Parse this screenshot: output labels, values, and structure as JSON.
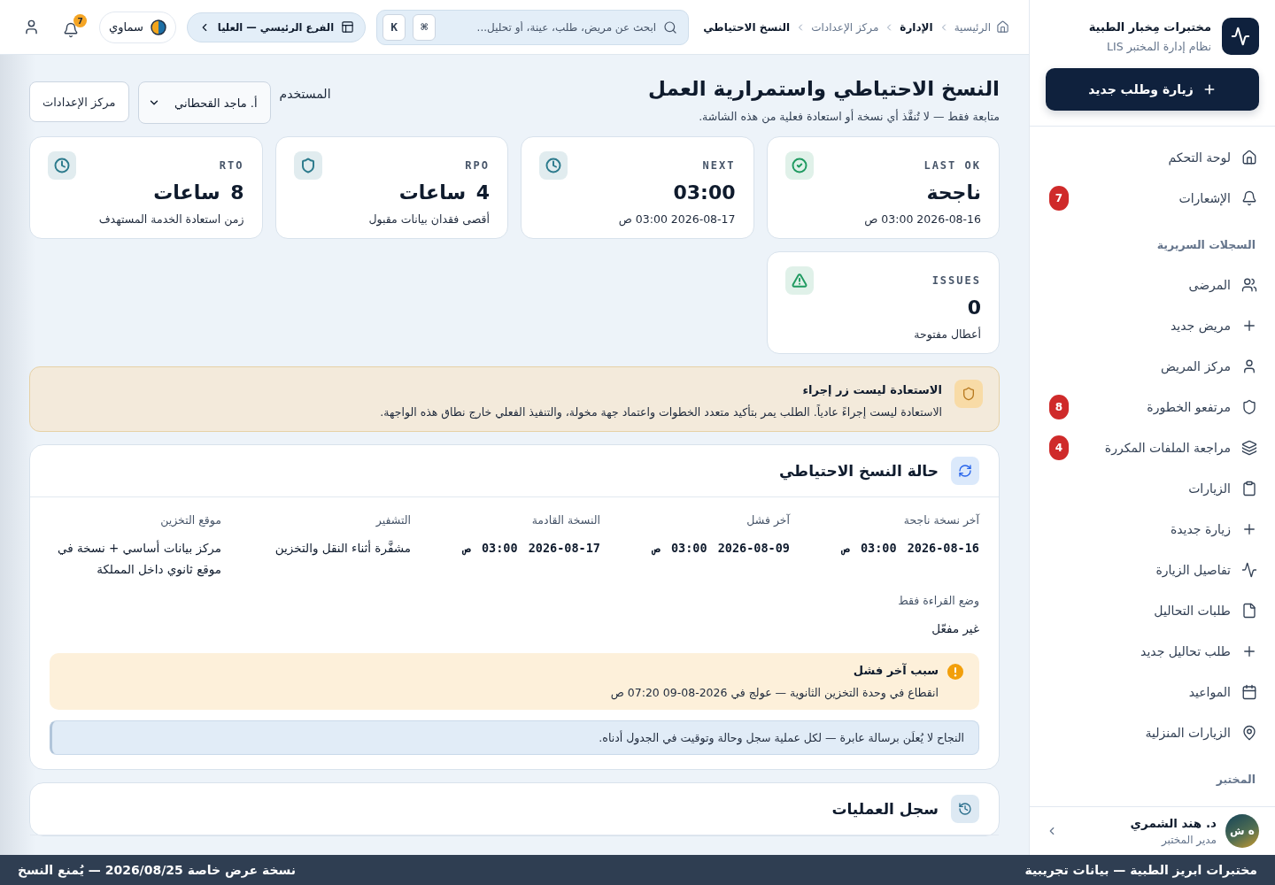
{
  "sidebar": {
    "brand": {
      "title": "مختبرات مِخبار الطبية",
      "subtitle": "نظام إدارة المختبر LIS"
    },
    "primary_action": "زيارة وطلب جديد",
    "nav": [
      {
        "kind": "link",
        "label": "لوحة التحكم",
        "selected": false
      },
      {
        "kind": "link",
        "label": "الإشعارات",
        "selected": false,
        "badge": "7"
      },
      {
        "kind": "section",
        "label": "السجلات السريرية"
      },
      {
        "kind": "link",
        "label": "المرضى",
        "selected": false
      },
      {
        "kind": "link",
        "label": "مريض جديد",
        "selected": false
      },
      {
        "kind": "link",
        "label": "مركز المريض",
        "selected": false
      },
      {
        "kind": "link",
        "label": "مرتفعو الخطورة",
        "selected": false,
        "badge": "8"
      },
      {
        "kind": "link",
        "label": "مراجعة الملفات المكررة",
        "selected": false,
        "badge": "4"
      },
      {
        "kind": "link",
        "label": "الزيارات",
        "selected": false
      },
      {
        "kind": "link",
        "label": "زيارة جديدة",
        "selected": false
      },
      {
        "kind": "link",
        "label": "تفاصيل الزيارة",
        "selected": false
      },
      {
        "kind": "link",
        "label": "طلبات التحاليل",
        "selected": false
      },
      {
        "kind": "link",
        "label": "طلب تحاليل جديد",
        "selected": false
      },
      {
        "kind": "link",
        "label": "المواعيد",
        "selected": false
      },
      {
        "kind": "link",
        "label": "الزيارات المنزلية",
        "selected": false
      },
      {
        "kind": "section",
        "label": "المختبر"
      }
    ],
    "user": {
      "initials": "ه ش",
      "name": "د. هند الشمري",
      "role": "مدير المختبر"
    }
  },
  "topbar": {
    "breadcrumb": [
      {
        "kind": "home",
        "label": "الرئيسية"
      },
      {
        "kind": "section",
        "label": "الإدارة"
      },
      {
        "kind": "link",
        "label": "مركز الإعدادات"
      },
      {
        "kind": "current",
        "label": "النسخ الاحتياطي"
      }
    ],
    "search": {
      "placeholder": "ابحث عن مريض، طلب، عينة، أو تحليل...",
      "shortcut": [
        "⌘",
        "K"
      ]
    },
    "branch": "الفرع الرئيسي — العليا",
    "theme": "سماوي",
    "notifications": "7"
  },
  "page": {
    "title": "النسخ الاحتياطي واستمرارية العمل",
    "subtitle": "متابعة فقط — لا تُنفَّذ أي نسخة أو استعادة فعلية من هذه الشاشة.",
    "user_filter": {
      "label": "المستخدم",
      "value": "أ. ماجد القحطاني"
    },
    "settings_button": "مركز الإعدادات"
  },
  "kpis": [
    {
      "label": "LAST OK",
      "value": "ناجحة",
      "note": "2026-08-16 03:00 ص",
      "color": "#1f9a60"
    },
    {
      "label": "NEXT",
      "value": "03:00",
      "note": "2026-08-17 03:00 ص",
      "color": "#2b7a8c"
    },
    {
      "label": "RPO",
      "value": "4 ساعات",
      "note": "أقصى فقدان بيانات مقبول",
      "color": "#2b7a8c"
    },
    {
      "label": "RTO",
      "value": "8 ساعات",
      "note": "زمن استعادة الخدمة المستهدف",
      "color": "#2b7a8c"
    },
    {
      "label": "ISSUES",
      "value": "0",
      "note": "أعطال مفتوحة",
      "color": "#1f9a60"
    }
  ],
  "restore_notice": {
    "title": "الاستعادة ليست زر إجراء",
    "text": "الاستعادة ليست إجراءً عادياً. الطلب يمر بتأكيد متعدد الخطوات واعتماد جهة مخولة، والتنفيذ الفعلي خارج نطاق هذه الواجهة."
  },
  "backup_status": {
    "title": "حالة النسخ الاحتياطي",
    "fields": [
      {
        "kind": "datetime",
        "label": "آخر نسخة ناجحة",
        "value": "2026-08-16 03:00 ص"
      },
      {
        "kind": "datetime",
        "label": "آخر فشل",
        "value": "2026-08-09 03:00 ص"
      },
      {
        "kind": "datetime",
        "label": "النسخة القادمة",
        "value": "2026-08-17 03:00 ص"
      },
      {
        "kind": "text",
        "label": "التشفير",
        "value": "مشفَّرة أثناء النقل والتخزين"
      },
      {
        "kind": "text",
        "label": "موقع التخزين",
        "value": "مركز بيانات أساسي + نسخة في موقع ثانوي داخل المملكة"
      },
      {
        "kind": "text",
        "label": "وضع القراءة فقط",
        "value": "غير مفعّل"
      }
    ],
    "failure": {
      "title": "سبب آخر فشل",
      "text": "انقطاع في وحدة التخزين الثانوية — عولج في 2026-08-09 07:20 ص"
    },
    "note": "النجاح لا يُعلَن برسالة عابرة — لكل عملية سجل وحالة وتوقيت في الجدول أدناه."
  },
  "operations_log": {
    "title": "سجل العمليات"
  },
  "demo_banner": {
    "title": "مختبرات ابريز الطبية — بيانات تجريبية",
    "notice": "نسخة عرض خاصة 2026/08/25 — يُمنع النسخ"
  }
}
